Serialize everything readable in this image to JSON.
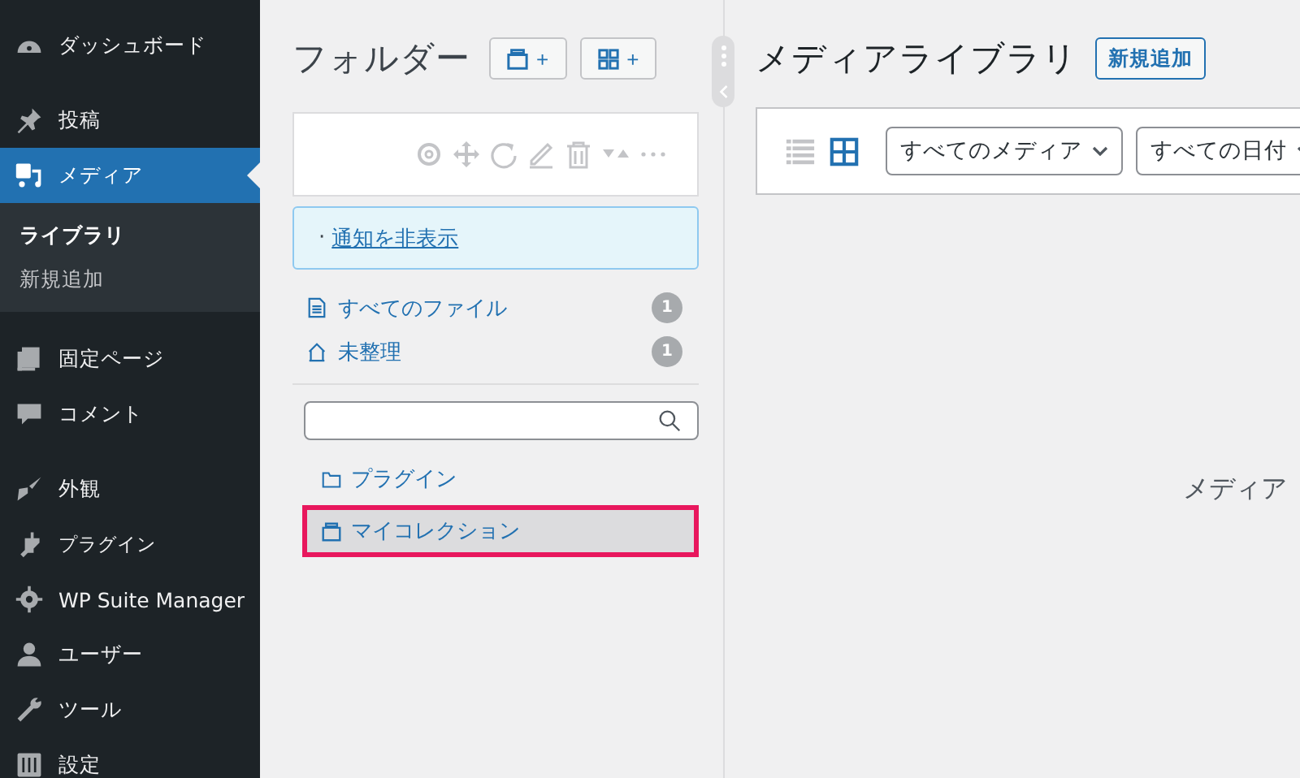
{
  "sidebar": {
    "items": [
      {
        "label": "ダッシュボード",
        "selected": false
      },
      {
        "label": "投稿",
        "selected": false
      },
      {
        "label": "メディア",
        "selected": true,
        "children": [
          {
            "label": "ライブラリ",
            "selected": true
          },
          {
            "label": "新規追加",
            "selected": false
          }
        ]
      },
      {
        "label": "固定ページ",
        "selected": false
      },
      {
        "label": "コメント",
        "selected": false
      },
      {
        "label": "外観",
        "selected": false
      },
      {
        "label": "プラグイン",
        "selected": false
      },
      {
        "label": "WP Suite Manager",
        "selected": false
      },
      {
        "label": "ユーザー",
        "selected": false
      },
      {
        "label": "ツール",
        "selected": false
      },
      {
        "label": "設定",
        "selected": false
      }
    ]
  },
  "folders": {
    "title": "フォルダー",
    "add_buttons": [
      "+",
      "+"
    ],
    "notice_link": "通知を非表示",
    "notice_bullet": "·",
    "special": [
      {
        "label": "すべてのファイル",
        "count": "1"
      },
      {
        "label": "未整理",
        "count": "1"
      }
    ],
    "tree": [
      {
        "label": "プラグイン",
        "selected": false
      },
      {
        "label": "マイコレクション",
        "selected": true
      }
    ]
  },
  "main": {
    "title": "メディアライブラリ",
    "add_button": "新規追加",
    "views": [
      {
        "selected": false
      },
      {
        "selected": true
      }
    ],
    "filters": [
      "すべてのメディア",
      "すべての日付"
    ],
    "empty_text": "メディア"
  }
}
